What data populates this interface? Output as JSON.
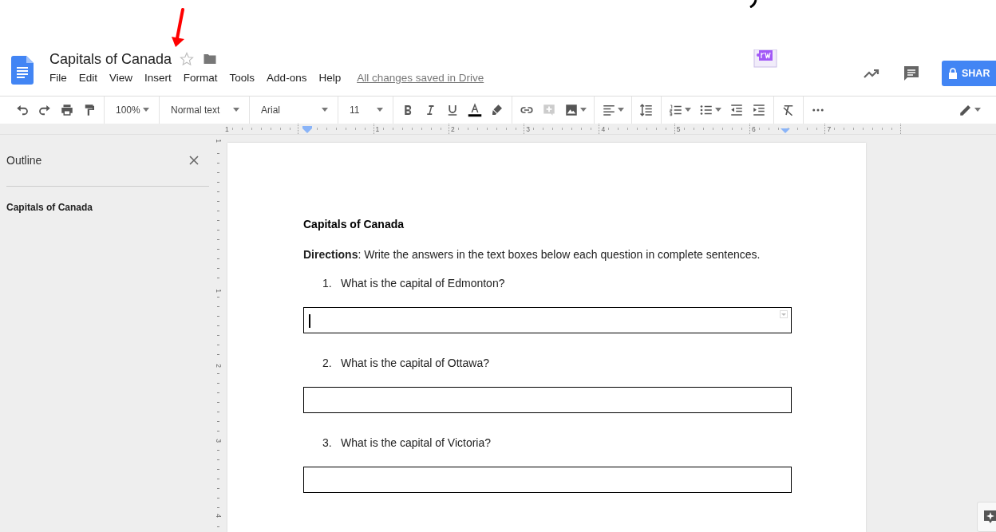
{
  "document": {
    "title": "Capitals of Canada",
    "starred": false
  },
  "menu": [
    "File",
    "Edit",
    "View",
    "Insert",
    "Format",
    "Tools",
    "Add-ons",
    "Help"
  ],
  "save_status": "All changes saved in Drive",
  "share_button": {
    "label": "SHAR"
  },
  "toolbar": {
    "zoom": "100%",
    "style": "Normal text",
    "font": "Arial",
    "size": "11"
  },
  "ruler": {
    "horizontal": [
      "1",
      "1",
      "2",
      "3",
      "4",
      "5",
      "6",
      "7"
    ],
    "vertical": [
      "1",
      "1",
      "2",
      "3",
      "4"
    ]
  },
  "outline": {
    "title": "Outline",
    "items": [
      "Capitals of Canada"
    ]
  },
  "page": {
    "heading": "Capitals of Canada",
    "directions": "**Directions**: Write the answers in the text boxes below each question in complete sentences.",
    "questions": [
      {
        "number": "1.",
        "text": "What is the capital of Edmonton?",
        "focused": true
      },
      {
        "number": "2.",
        "text": "What is the capital of Ottawa?",
        "focused": false
      },
      {
        "number": "3.",
        "text": "What is the capital of Victoria?",
        "focused": false
      }
    ]
  }
}
